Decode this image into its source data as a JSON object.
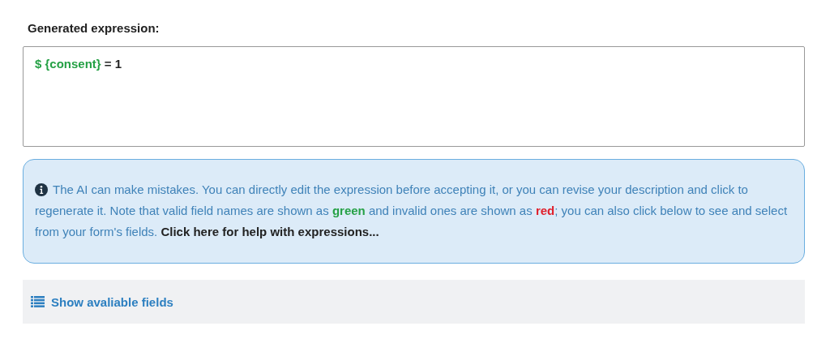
{
  "label": "Generated expression:",
  "expression": [
    {
      "kind": "field",
      "text": "$ {consent}",
      "valid": true
    },
    {
      "kind": "text",
      "text": " = 1"
    }
  ],
  "notice": {
    "parts": [
      {
        "kind": "text",
        "text": "The AI can make mistakes. You can directly edit the expression before accepting it, or you can revise your description and click to regenerate it. Note that valid field names are shown as "
      },
      {
        "kind": "valid",
        "text": "green"
      },
      {
        "kind": "text",
        "text": " and invalid ones are shown as "
      },
      {
        "kind": "invalid",
        "text": "red"
      },
      {
        "kind": "text",
        "text": "; you can also click below to see and select from your form's fields. "
      },
      {
        "kind": "link",
        "text": "Click here for help with expressions..."
      }
    ]
  },
  "fields_toggle": {
    "label": "Show avaliable fields",
    "expanded": false
  }
}
